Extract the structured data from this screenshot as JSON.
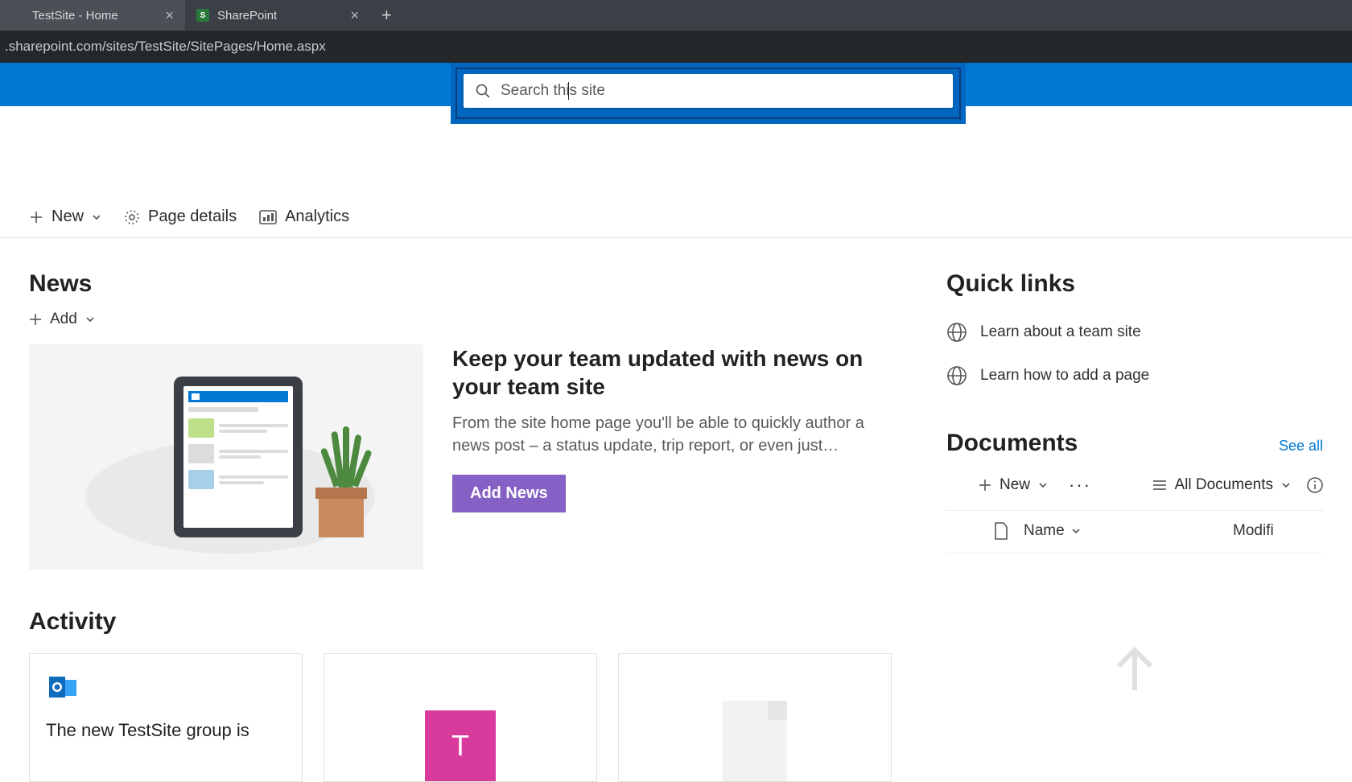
{
  "browser": {
    "tabs": [
      {
        "title": "TestSite - Home"
      },
      {
        "title": "SharePoint"
      }
    ],
    "url": ".sharepoint.com/sites/TestSite/SitePages/Home.aspx"
  },
  "search": {
    "placeholder": "Search this site"
  },
  "commandbar": {
    "new": "New",
    "page_details": "Page details",
    "analytics": "Analytics"
  },
  "news": {
    "heading": "News",
    "add": "Add",
    "title": "Keep your team updated with news on your team site",
    "desc": "From the site home page you'll be able to quickly author a news post – a status update, trip report, or even just…",
    "button": "Add News"
  },
  "activity": {
    "heading": "Activity",
    "card1_text": "The new TestSite group is",
    "card2_letter": "T"
  },
  "quicklinks": {
    "heading": "Quick links",
    "items": [
      "Learn about a team site",
      "Learn how to add a page"
    ]
  },
  "documents": {
    "heading": "Documents",
    "see_all": "See all",
    "new": "New",
    "view": "All Documents",
    "col_name": "Name",
    "col_modified": "Modifi"
  }
}
